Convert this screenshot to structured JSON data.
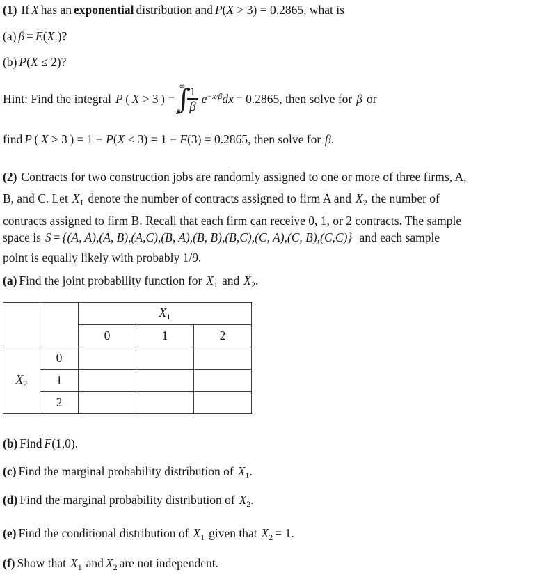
{
  "document": {
    "type": "probability-homework-worksheet",
    "background_color": "#ffffff",
    "text_color": "#1a1a1a"
  },
  "problem1": {
    "number": "(1)",
    "stem_part1": "If",
    "var_x": "X",
    "stem_part2": "has an",
    "keyword": "exponential",
    "stem_part3": "distribution and",
    "prob_expr": "P(X > 3) = 0.2865",
    "stem_part4": ", what is",
    "items": [
      {
        "label": "(a)",
        "text_beta": "β",
        "equals": "=",
        "expr": "E(X )?"
      },
      {
        "label": "(b)",
        "expr": "P(X ≤ 2)?"
      }
    ],
    "hint": {
      "lead": "Hint: Find the integral",
      "lhs": "P ( X > 3 ) =",
      "integral": {
        "symbol": "∫",
        "upper_limit": "∞",
        "lower_limit": "3",
        "fraction_numerator": "1",
        "fraction_denominator": "β",
        "exponential_base": "e",
        "exponent": "−x/β",
        "differential": "dx"
      },
      "result": "= 0.2865",
      "tail": ", then solve for",
      "beta": "β",
      "or": "or"
    },
    "alt_hint": {
      "text": "find P ( X > 3 ) = 1 − P ( X ≤ 3 ) = 1 − F (3) = 0.2865 , then solve for β .",
      "lead": "find",
      "expr": "P ( X > 3 ) = 1 − P ( X ≤ 3 ) = 1 − F (3) = 0.2865",
      "tail": ", then solve for",
      "beta": "β",
      "period": "."
    }
  },
  "problem2": {
    "number": "(2)",
    "body_lines": [
      "Contracts for two construction jobs are randomly assigned to one or more of three firms, A,",
      "B, and C. Let X₁ denote the number of contracts assigned to firm A and X₂ the number of",
      "contracts assigned to firm B. Recall that each firm can receive 0, 1, or 2 contracts. The sample",
      "space is S = {(A, A),(A, B),(A,C),(B, A),(B, B),(B,C),(C, A),(C, B),(C,C)}  and each sample",
      "point is equally likely with probably 1/9."
    ],
    "line1": {
      "text": "Contracts for two construction jobs are randomly assigned to one or more of three firms, A,"
    },
    "line2": {
      "pre": "B, and C. Let",
      "var1": "X",
      "var1_sub": "1",
      "mid": "denote the number of contracts assigned to firm A and",
      "var2": "X",
      "var2_sub": "2",
      "post": "the number of"
    },
    "line3": {
      "text": "contracts assigned to firm B. Recall that each firm can receive 0, 1, or 2 contracts. The sample"
    },
    "line4": {
      "pre": "space is",
      "var_s": "S",
      "equals": "=",
      "set": "{(A, A),(A, B),(A,C),(B, A),(B, B),(B,C),(C, A),(C, B),(C,C)}",
      "post": "and each sample"
    },
    "line5": {
      "text": "point is equally likely with probably 1/9."
    },
    "items": [
      {
        "label": "(a)",
        "pre": "Find the joint probability function for",
        "var1": "X",
        "var1_sub": "1",
        "conj": "and",
        "var2": "X",
        "var2_sub": "2",
        "period": "."
      },
      {
        "label": "(b)",
        "pre": "Find",
        "func": "F",
        "args": "(1,0).",
        "var1": "",
        "var1_sub": "",
        "conj": "",
        "var2": "",
        "var2_sub": "",
        "period": ""
      },
      {
        "label": "(c)",
        "pre": "Find the marginal probability distribution of",
        "var1": "X",
        "var1_sub": "1",
        "period": "."
      },
      {
        "label": "(d)",
        "pre": "Find the marginal probability distribution of",
        "var1": "X",
        "var1_sub": "2",
        "period": "."
      },
      {
        "label": "(e)",
        "pre": "Find the conditional distribution of",
        "var1": "X",
        "var1_sub": "1",
        "mid": "given that",
        "var2": "X",
        "var2_sub": "2",
        "eq": "= 1."
      },
      {
        "label": "(f)",
        "pre": "Show that",
        "var1": "X",
        "var1_sub": "1",
        "conj": "and",
        "var2": "X",
        "var2_sub": "2",
        "post": "are not independent."
      }
    ]
  },
  "joint_table": {
    "col_header_label": "X",
    "col_header_sub": "1",
    "row_header_label": "X",
    "row_header_sub": "2",
    "col_values": [
      "0",
      "1",
      "2"
    ],
    "row_values": [
      "0",
      "1",
      "2"
    ],
    "cells": [
      [
        "",
        "",
        ""
      ],
      [
        "",
        "",
        ""
      ],
      [
        "",
        "",
        ""
      ]
    ],
    "border_color": "#3a3a3a"
  }
}
